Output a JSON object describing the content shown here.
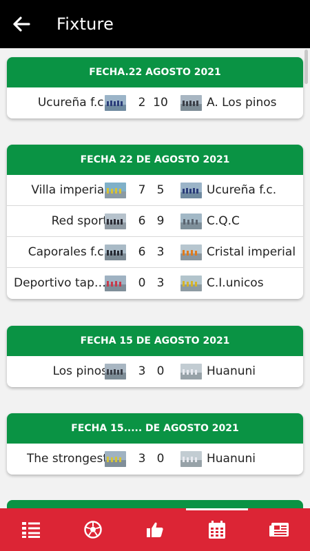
{
  "header": {
    "title": "Fixture"
  },
  "cards": [
    {
      "date": "FECHA.22 AGOSTO 2021",
      "matches": [
        {
          "home": "Ucureña f.c.",
          "home_score": "2",
          "away_score": "10",
          "away": "A. Los pinos"
        }
      ]
    },
    {
      "date": "FECHA 22 DE AGOSTO 2021",
      "matches": [
        {
          "home": "Villa imperial",
          "home_score": "7",
          "away_score": "5",
          "away": "Ucureña f.c."
        },
        {
          "home": "Red sport",
          "home_score": "6",
          "away_score": "9",
          "away": "C.Q.C"
        },
        {
          "home": "Caporales f.c.",
          "home_score": "6",
          "away_score": "3",
          "away": "Cristal imperial"
        },
        {
          "home": "Deportivo tapacari",
          "home_score": "0",
          "away_score": "3",
          "away": "C.I.unicos"
        }
      ]
    },
    {
      "date": "FECHA 15 DE AGOSTO 2021",
      "matches": [
        {
          "home": "Los pinos",
          "home_score": "3",
          "away_score": "0",
          "away": "Huanuni"
        }
      ]
    },
    {
      "date": "FECHA 15..... DE AGOSTO 2021",
      "matches": [
        {
          "home": "The strongest",
          "home_score": "3",
          "away_score": "0",
          "away": "Huanuni"
        }
      ]
    }
  ],
  "bottom_nav": [
    {
      "icon": "standings-list-icon"
    },
    {
      "icon": "soccer-ball-icon"
    },
    {
      "icon": "thumbs-up-icon"
    },
    {
      "icon": "calendar-icon",
      "active": true
    },
    {
      "icon": "news-icon"
    }
  ],
  "colors": {
    "header_green": "#0a9344",
    "app_bar": "#000000",
    "bottom_bar": "#dc2535"
  }
}
